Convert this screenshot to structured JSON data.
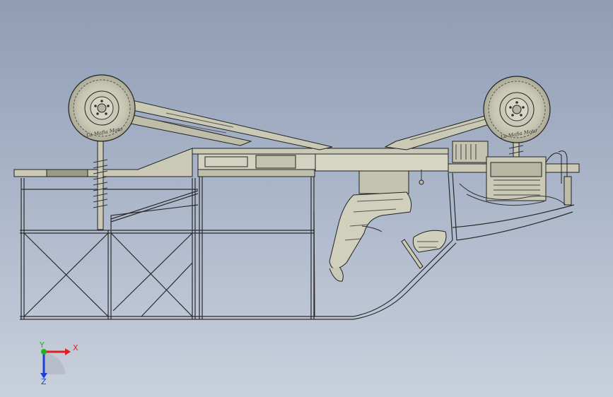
{
  "viewport": {
    "background_top": "#8f9cb4",
    "background_bottom": "#c9d0dd"
  },
  "model": {
    "frame_color": "#c9c9b6",
    "edge_color": "#222222",
    "tire_brand": "La Mafia Moto"
  },
  "triad": {
    "x_label": "X",
    "y_label": "Y",
    "z_label": "Z",
    "x_color": "#e02020",
    "y_color": "#20b020",
    "z_color": "#2040d0"
  }
}
